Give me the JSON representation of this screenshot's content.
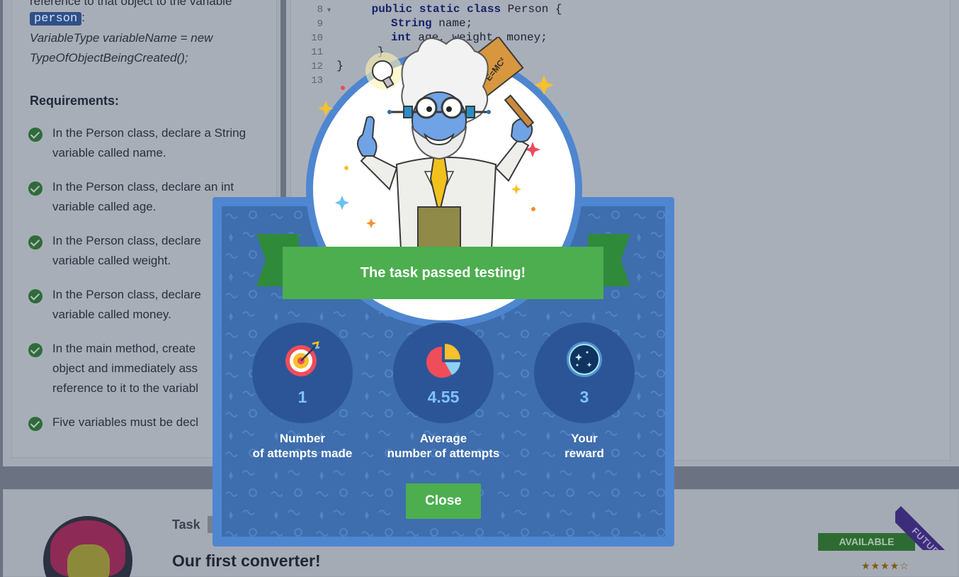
{
  "task_description": {
    "intro_line_1": "reference to that object to the variable",
    "highlight_var": "person",
    "intro_colon": ":",
    "syntax_line_1": "VariableType variableName = new",
    "syntax_line_2": "TypeOfObjectBeingCreated();",
    "requirements_title": "Requirements:",
    "requirements": [
      {
        "line1": "In the Person class, declare a String",
        "line2": "variable called name."
      },
      {
        "line1": "In the Person class, declare an int",
        "line2": "variable called age."
      },
      {
        "line1": "In the Person class, declare",
        "line2": "variable called weight."
      },
      {
        "line1": "In the Person class, declare",
        "line2": "variable called money."
      },
      {
        "line1": "In the main method, create",
        "line2": "object and immediately ass",
        "line3": "reference to it to the variabl"
      },
      {
        "line1": "Five variables must be decl"
      }
    ]
  },
  "code_editor": {
    "lines": [
      {
        "num": "8",
        "code_kw": "public static class",
        "code_rest": " Person {",
        "indent": "  "
      },
      {
        "num": "9",
        "code_kw": "String",
        "code_rest": " name;",
        "indent": "    "
      },
      {
        "num": "10",
        "code_kw": "int",
        "code_rest": " age, weight, money;",
        "indent": "    "
      },
      {
        "num": "11",
        "code_kw": "",
        "code_rest": "}",
        "indent": "  "
      },
      {
        "num": "12",
        "code_kw": "",
        "code_rest": "}",
        "indent": ""
      },
      {
        "num": "13",
        "code_kw": "",
        "code_rest": "",
        "indent": ""
      }
    ]
  },
  "modal": {
    "banner_text": "The task passed testing!",
    "sign_text": "E=MC²",
    "stats": [
      {
        "value": "1",
        "label_line1": "Number",
        "label_line2": "of attempts made",
        "icon": "target-icon"
      },
      {
        "value": "4.55",
        "label_line1": "Average",
        "label_line2": "number of attempts",
        "icon": "pie-chart-icon"
      },
      {
        "value": "3",
        "label_line1": "Your",
        "label_line2": "reward",
        "icon": "dark-matter-icon"
      }
    ],
    "close_label": "Close"
  },
  "next_task": {
    "task_label": "Task",
    "title": "Our first converter!",
    "status": "AVAILABLE",
    "ribbon": "FUTURE",
    "stars": "★★★★☆"
  },
  "colors": {
    "banner_green": "#4cae4f",
    "modal_blue": "#3e6eae",
    "stat_value_blue": "#7fc1ff"
  }
}
